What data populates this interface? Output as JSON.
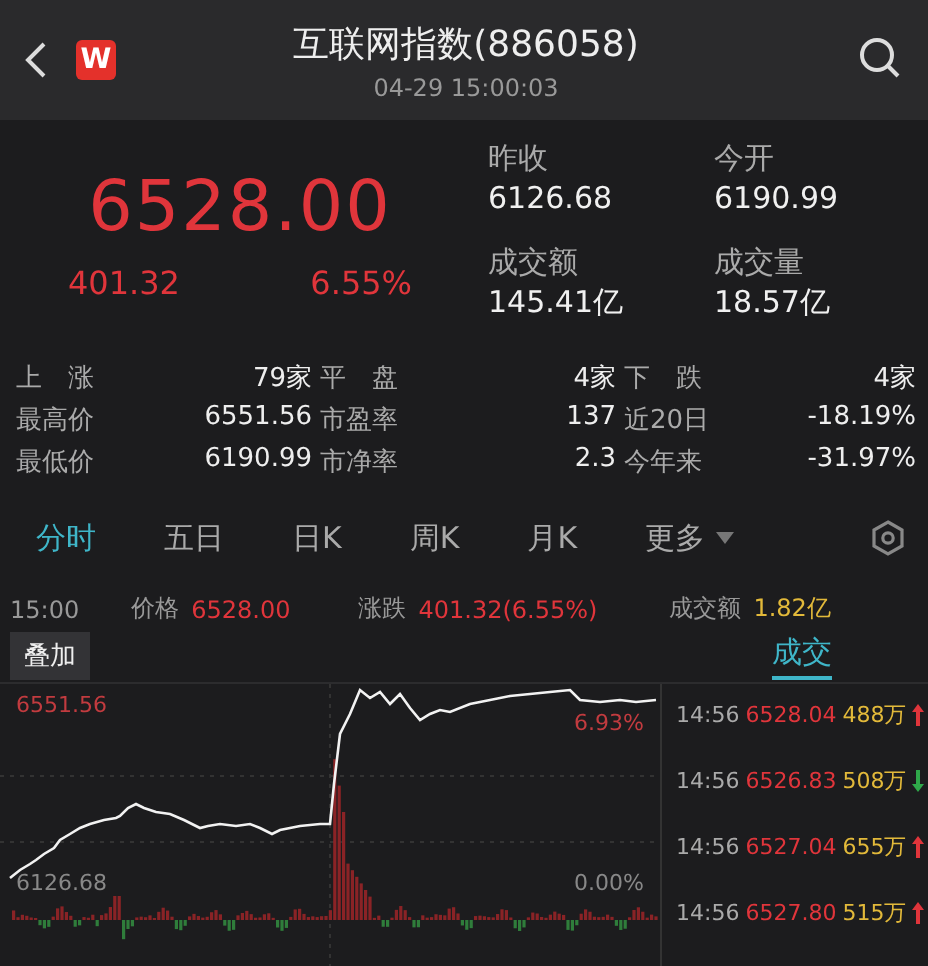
{
  "header": {
    "logo": "W",
    "title": "互联网指数(886058)",
    "time": "04-29 15:00:03"
  },
  "quote": {
    "price": "6528.00",
    "change": "401.32",
    "percent": "6.55%"
  },
  "summary": [
    {
      "label": "昨收",
      "value": "6126.68"
    },
    {
      "label": "今开",
      "value": "6190.99"
    },
    {
      "label": "成交额",
      "value": "145.41亿"
    },
    {
      "label": "成交量",
      "value": "18.57亿"
    }
  ],
  "stats": [
    [
      {
        "label": "上　涨",
        "value": "79家"
      },
      {
        "label": "平　盘",
        "value": "4家"
      },
      {
        "label": "下　跌",
        "value": "4家"
      }
    ],
    [
      {
        "label": "最高价",
        "value": "6551.56"
      },
      {
        "label": "市盈率",
        "value": "137"
      },
      {
        "label": "近20日",
        "value": "-18.19%"
      }
    ],
    [
      {
        "label": "最低价",
        "value": "6190.99"
      },
      {
        "label": "市净率",
        "value": "2.3"
      },
      {
        "label": "今年来",
        "value": "-31.97%"
      }
    ]
  ],
  "tabs": [
    {
      "label": "分时",
      "selected": true
    },
    {
      "label": "五日",
      "selected": false
    },
    {
      "label": "日K",
      "selected": false
    },
    {
      "label": "周K",
      "selected": false
    },
    {
      "label": "月K",
      "selected": false
    },
    {
      "label": "更多",
      "selected": false
    }
  ],
  "info": {
    "time": "15:00",
    "price_label": "价格",
    "price": "6528.00",
    "change_label": "涨跌",
    "change": "401.32(6.55%)",
    "amount_label": "成交额",
    "amount": "1.82亿"
  },
  "overlay_button": "叠加",
  "trades_tab": {
    "label": "成交",
    "selected": true
  },
  "chart": {
    "high": "6551.56",
    "high_pct": "6.93%",
    "base": "6126.68",
    "base_pct": "0.00%"
  },
  "trades": [
    {
      "time": "14:56",
      "price": "6528.04",
      "volume": "488万",
      "kind": "up"
    },
    {
      "time": "14:56",
      "price": "6526.83",
      "volume": "508万",
      "kind": "down"
    },
    {
      "time": "14:56",
      "price": "6527.04",
      "volume": "655万",
      "kind": "up"
    },
    {
      "time": "14:56",
      "price": "6527.80",
      "volume": "515万",
      "kind": "up"
    }
  ]
}
